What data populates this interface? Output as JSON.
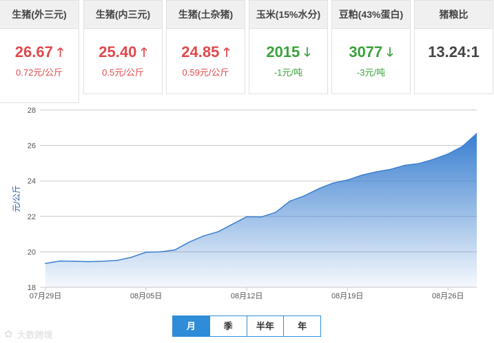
{
  "cards": [
    {
      "label": "生猪(外三元)",
      "price": "26.67",
      "change": "0.72元/公斤",
      "trend": "up",
      "arrow": "🡑"
    },
    {
      "label": "生猪(内三元)",
      "price": "25.40",
      "change": "0.5元/公斤",
      "trend": "up",
      "arrow": "🡑"
    },
    {
      "label": "生猪(土杂猪)",
      "price": "24.85",
      "change": "0.59元/公斤",
      "trend": "up",
      "arrow": "🡑"
    },
    {
      "label": "玉米(15%水分)",
      "price": "2015",
      "change": "-1元/吨",
      "trend": "down",
      "arrow": "🡓"
    },
    {
      "label": "豆粕(43%蛋白)",
      "price": "3077",
      "change": "-3元/吨",
      "trend": "down",
      "arrow": "🡓"
    },
    {
      "label": "猪粮比",
      "price": "13.24:1",
      "change": "",
      "trend": "neutral",
      "arrow": ""
    }
  ],
  "colors": {
    "up": "#e0484b",
    "down": "#3ba23b",
    "line": "#3a7fd0",
    "fill_top": "#3a7fd0",
    "tab_active": "#2f8cd8"
  },
  "chart_data": {
    "type": "area",
    "title": "",
    "xlabel": "",
    "ylabel": "元/公斤",
    "ylim": [
      18,
      28
    ],
    "yticks": [
      18,
      20,
      22,
      24,
      26,
      28
    ],
    "grid": "horizontal",
    "x_tick_labels": [
      {
        "index": 0,
        "label": "07月29日"
      },
      {
        "index": 7,
        "label": "08月05日"
      },
      {
        "index": 14,
        "label": "08月12日"
      },
      {
        "index": 21,
        "label": "08月19日"
      },
      {
        "index": 28,
        "label": "08月26日"
      }
    ],
    "x": [
      "07-29",
      "07-30",
      "07-31",
      "08-01",
      "08-02",
      "08-03",
      "08-04",
      "08-05",
      "08-06",
      "08-07",
      "08-08",
      "08-09",
      "08-10",
      "08-11",
      "08-12",
      "08-13",
      "08-14",
      "08-15",
      "08-16",
      "08-17",
      "08-18",
      "08-19",
      "08-20",
      "08-21",
      "08-22",
      "08-23",
      "08-24",
      "08-25",
      "08-26",
      "08-27",
      "08-28"
    ],
    "series": [
      {
        "values": [
          19.35,
          19.48,
          19.47,
          19.45,
          19.47,
          19.52,
          19.7,
          19.98,
          20.0,
          20.11,
          20.55,
          20.9,
          21.13,
          21.56,
          21.98,
          21.97,
          22.22,
          22.86,
          23.16,
          23.56,
          23.88,
          24.05,
          24.32,
          24.51,
          24.65,
          24.88,
          24.98,
          25.22,
          25.52,
          25.94,
          26.67
        ]
      }
    ]
  },
  "range_tabs": [
    {
      "label": "月",
      "active": true
    },
    {
      "label": "季",
      "active": false
    },
    {
      "label": "半年",
      "active": false
    },
    {
      "label": "年",
      "active": false
    }
  ],
  "watermark": {
    "icon": "wechat-icon",
    "text": "大数跨境"
  }
}
